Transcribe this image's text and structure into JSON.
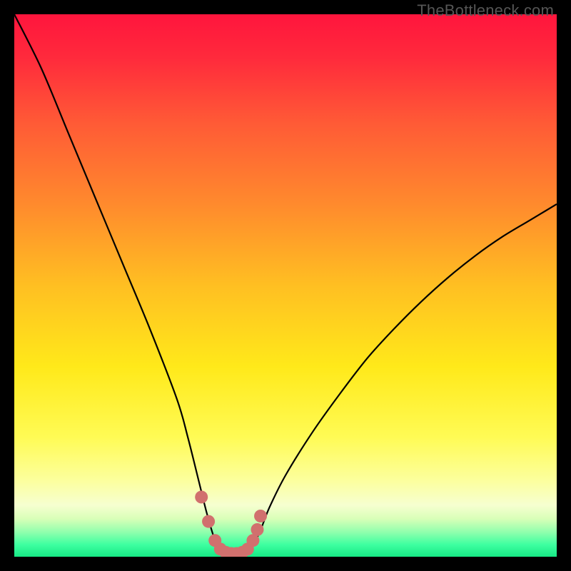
{
  "watermark": "TheBottleneck.com",
  "chart_data": {
    "type": "line",
    "title": "",
    "xlabel": "",
    "ylabel": "",
    "xlim": [
      0,
      100
    ],
    "ylim": [
      0,
      100
    ],
    "grid": false,
    "series": [
      {
        "name": "bottleneck-curve",
        "x": [
          0,
          5,
          10,
          15,
          20,
          25,
          30,
          32,
          34,
          35.5,
          37,
          38,
          39,
          40,
          41,
          42,
          43,
          45,
          47,
          50,
          55,
          60,
          65,
          70,
          75,
          80,
          85,
          90,
          95,
          100
        ],
        "y": [
          100,
          90,
          78,
          66,
          54,
          42,
          29,
          22,
          14,
          8,
          3,
          1,
          0.3,
          0.1,
          0.1,
          0.3,
          1,
          4,
          9,
          15,
          23,
          30,
          36.5,
          42,
          47,
          51.5,
          55.5,
          59,
          62,
          65
        ]
      }
    ],
    "markers": {
      "name": "highlight-dots",
      "color": "#d1706e",
      "points": [
        {
          "x": 34.5,
          "y": 11
        },
        {
          "x": 35.8,
          "y": 6.5
        },
        {
          "x": 37.0,
          "y": 3.0
        },
        {
          "x": 38.0,
          "y": 1.4
        },
        {
          "x": 39.0,
          "y": 0.8
        },
        {
          "x": 40.0,
          "y": 0.6
        },
        {
          "x": 41.0,
          "y": 0.6
        },
        {
          "x": 42.0,
          "y": 0.8
        },
        {
          "x": 43.0,
          "y": 1.4
        },
        {
          "x": 44.0,
          "y": 3.0
        },
        {
          "x": 44.8,
          "y": 5.0
        },
        {
          "x": 45.4,
          "y": 7.5
        }
      ]
    },
    "background_gradient": {
      "stops": [
        {
          "offset": 0.0,
          "color": "#ff153d"
        },
        {
          "offset": 0.08,
          "color": "#ff2a3c"
        },
        {
          "offset": 0.2,
          "color": "#ff5a36"
        },
        {
          "offset": 0.35,
          "color": "#ff8a2d"
        },
        {
          "offset": 0.5,
          "color": "#ffbf22"
        },
        {
          "offset": 0.65,
          "color": "#ffe91a"
        },
        {
          "offset": 0.78,
          "color": "#fffb55"
        },
        {
          "offset": 0.86,
          "color": "#fcff9e"
        },
        {
          "offset": 0.905,
          "color": "#f6ffd0"
        },
        {
          "offset": 0.93,
          "color": "#d9ffb8"
        },
        {
          "offset": 0.955,
          "color": "#8fffad"
        },
        {
          "offset": 0.978,
          "color": "#3dffa0"
        },
        {
          "offset": 1.0,
          "color": "#17e885"
        }
      ]
    }
  }
}
